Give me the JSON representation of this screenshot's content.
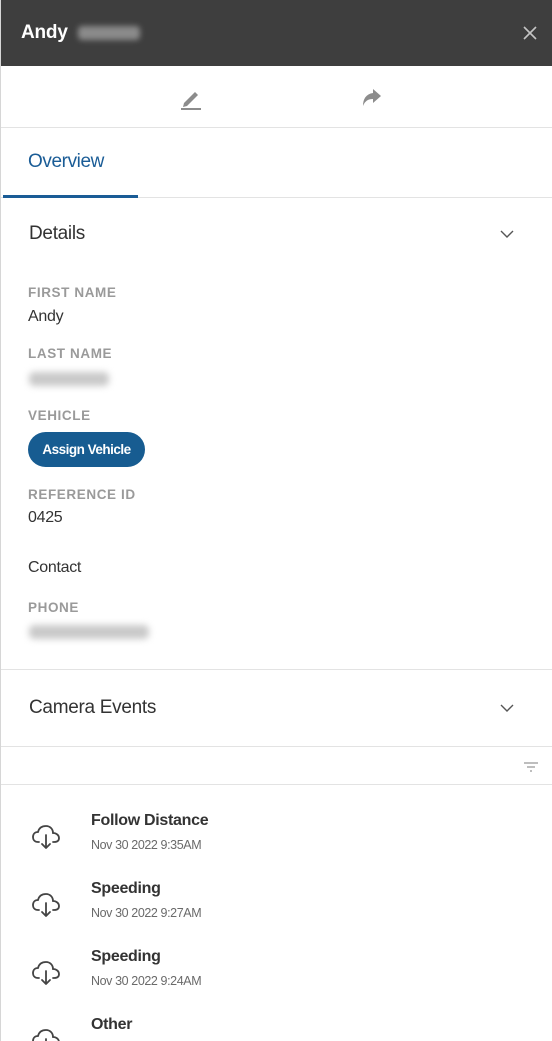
{
  "header": {
    "first_name": "Andy",
    "close_icon": "close-icon"
  },
  "toolbar": {
    "edit_icon": "pencil-icon",
    "share_icon": "share-arrow-icon"
  },
  "tabs": [
    {
      "label": "Overview",
      "active": true
    }
  ],
  "details": {
    "section_title": "Details",
    "first_name_label": "FIRST NAME",
    "first_name_value": "Andy",
    "last_name_label": "LAST NAME",
    "vehicle_label": "VEHICLE",
    "assign_vehicle_label": "Assign Vehicle",
    "reference_id_label": "REFERENCE ID",
    "reference_id_value": "0425",
    "contact_label": "Contact",
    "phone_label": "PHONE"
  },
  "camera_events": {
    "section_title": "Camera Events",
    "filter_icon": "filter-icon",
    "items": [
      {
        "title": "Follow Distance",
        "time": "Nov 30 2022 9:35AM",
        "icon": "cloud-download-icon"
      },
      {
        "title": "Speeding",
        "time": "Nov 30 2022 9:27AM",
        "icon": "cloud-download-icon"
      },
      {
        "title": "Speeding",
        "time": "Nov 30 2022 9:24AM",
        "icon": "cloud-download-icon"
      },
      {
        "title": "Other",
        "time": "",
        "icon": "cloud-download-icon"
      }
    ]
  },
  "colors": {
    "header_bg": "#3e3e3e",
    "accent": "#1a5c96",
    "label_gray": "#9a9a9a"
  }
}
